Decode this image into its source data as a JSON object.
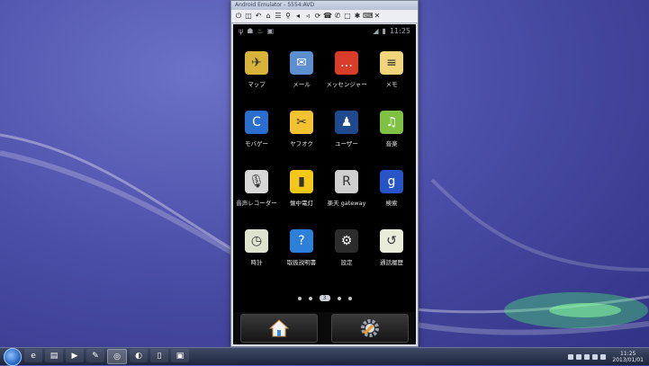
{
  "emulator": {
    "title": "Android Emulator - 5554:AVD",
    "toolbar_icons": [
      "power-icon",
      "camera-icon",
      "back-icon",
      "home-icon",
      "menu-icon",
      "search-icon",
      "volume-up-icon",
      "volume-down-icon",
      "rotate-icon",
      "phone-icon",
      "end-call-icon",
      "screenshot-icon",
      "settings-icon",
      "keyboard-icon",
      "close-icon"
    ]
  },
  "status_bar": {
    "time": "11:25",
    "left_icons": [
      "usb-icon",
      "android-icon",
      "notify-icon",
      "app-icon"
    ],
    "right_icons": [
      "signal-icon",
      "battery-icon"
    ]
  },
  "apps": [
    {
      "label": "マップ",
      "icon": "map-icon",
      "color": "#d9b23a",
      "glyph": "✈"
    },
    {
      "label": "メール",
      "icon": "mail-icon",
      "color": "#5c8fcf",
      "glyph": "✉"
    },
    {
      "label": "メッセンジャー",
      "icon": "messenger-icon",
      "color": "#d83d2a",
      "glyph": "…"
    },
    {
      "label": "メモ",
      "icon": "memo-icon",
      "color": "#f1d57a",
      "glyph": "≡"
    },
    {
      "label": "モバゲー",
      "icon": "mobage-icon",
      "color": "#2a6fd0",
      "glyph": "C"
    },
    {
      "label": "ヤフオク",
      "icon": "yahoo-auction-icon",
      "color": "#f2c230",
      "glyph": "✂"
    },
    {
      "label": "ユーザー",
      "icon": "user-icon",
      "color": "#1f4b8e",
      "glyph": "♟"
    },
    {
      "label": "音楽",
      "icon": "music-icon",
      "color": "#7fc243",
      "glyph": "♫"
    },
    {
      "label": "音声レコーダー",
      "icon": "voice-recorder-icon",
      "color": "#d8d8d8",
      "glyph": "🎙"
    },
    {
      "label": "懐中電灯",
      "icon": "flashlight-icon",
      "color": "#f5c718",
      "glyph": "▮"
    },
    {
      "label": "楽天 gateway",
      "icon": "rakuten-icon",
      "color": "#cfcfcf",
      "glyph": "R"
    },
    {
      "label": "検索",
      "icon": "google-search-icon",
      "color": "#2754c7",
      "glyph": "g"
    },
    {
      "label": "時計",
      "icon": "clock-icon",
      "color": "#dde3cc",
      "glyph": "◷"
    },
    {
      "label": "取扱説明書",
      "icon": "help-icon",
      "color": "#2e7fd8",
      "glyph": "?"
    },
    {
      "label": "設定",
      "icon": "settings-icon",
      "color": "#2c2c2c",
      "glyph": "⚙"
    },
    {
      "label": "通話履歴",
      "icon": "call-log-icon",
      "color": "#e8ecd8",
      "glyph": "↺"
    }
  ],
  "page_indicator": {
    "current": "3",
    "total": 5
  },
  "dock": {
    "home_icon": "home-icon",
    "settings_icon": "settings-gear-icon"
  },
  "taskbar": {
    "items": [
      {
        "icon": "windows-start-icon"
      },
      {
        "icon": "ie-icon",
        "glyph": "e"
      },
      {
        "icon": "folder-icon",
        "glyph": "▤"
      },
      {
        "icon": "media-player-icon",
        "glyph": "▶"
      },
      {
        "icon": "paint-icon",
        "glyph": "✎"
      },
      {
        "icon": "emulator-icon",
        "glyph": "◎"
      },
      {
        "icon": "firefox-icon",
        "glyph": "◐"
      },
      {
        "icon": "document-icon",
        "glyph": "▯"
      },
      {
        "icon": "android-task-icon",
        "glyph": "▣"
      }
    ],
    "tray_time": "11:25",
    "tray_date": "2013/01/01"
  }
}
